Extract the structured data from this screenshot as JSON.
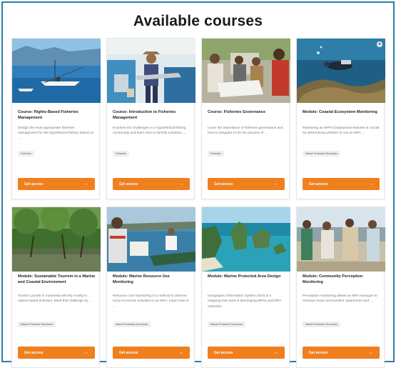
{
  "page": {
    "title": "Available courses"
  },
  "accent_color": "#f07f1e",
  "courses": [
    {
      "title": "Course: Rights-Based Fisheries Management",
      "description": "Design the most appropriate fisheries management for the hypothetical fishery based on ...",
      "tag": "Fisheries",
      "button_label": "Get access",
      "button_icon": "arrow-right-icon",
      "image": "fishing-boats-on-sea"
    },
    {
      "title": "Course: Introduction to Fisheries Management",
      "description": "Examine the challenges in a hypothetical fishing community and learn how to identify solutions ...",
      "tag": "Fisheries",
      "button_label": "Get access",
      "button_icon": "arrow-right-icon",
      "image": "fisherman-holding-fish"
    },
    {
      "title": "Course: Fisheries Governance",
      "description": "Learn the importance of fisheries governance and how to integrate it into the process of ...",
      "tag": "Fisheries",
      "button_label": "Get access",
      "button_icon": "arrow-right-icon",
      "image": "community-meeting"
    },
    {
      "title": "Module: Coastal Ecosystem Monitoring",
      "description": "Monitoring an MPA's biophysical features is crucial for determining whether or not an MPA ...",
      "tag": "Marine Protected Sea Areas",
      "button_label": "Get access",
      "button_icon": "arrow-right-icon",
      "image": "scuba-diver-reef"
    },
    {
      "title": "Module: Sustainable Tourism in a Marine and Coastal Environment",
      "description": "Tourism growth in Indonesia will rely mostly in nature-based activities. Meet this challenge by ...",
      "tag": "Marine Protected Sea Areas",
      "button_label": "Get access",
      "button_icon": "arrow-right-icon",
      "image": "mangrove-forest"
    },
    {
      "title": "Module: Marine Resource Use Monitoring",
      "description": "Resource Use Monitoring is a method to observe socio-economic activities in an MPA. Learn how to ...",
      "tag": "Marine Protected Sea Areas",
      "button_label": "Get access",
      "button_icon": "arrow-right-icon",
      "image": "survey-on-boat"
    },
    {
      "title": "Module: Marine Protected Area Design",
      "description": "Geographic Information System (GIS) is a mapping tool used in developing MPAs and MPA networks ...",
      "tag": "Marine Protected Sea Areas",
      "button_label": "Get access",
      "button_icon": "arrow-right-icon",
      "image": "rocky-islands"
    },
    {
      "title": "Module: Community Perception Monitoring",
      "description": "Perception monitoring allows an MPA manager to measure local communities' awareness and ...",
      "tag": "Marine Protected Sea Areas",
      "button_label": "Get access",
      "button_icon": "arrow-right-icon",
      "image": "villagers-outdoors"
    }
  ]
}
